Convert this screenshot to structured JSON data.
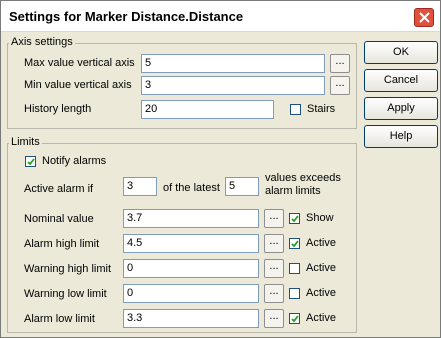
{
  "window": {
    "title": "Settings for Marker Distance.Distance"
  },
  "axis": {
    "legend": "Axis settings",
    "max_label": "Max value vertical axis",
    "max_value": "5",
    "min_label": "Min value vertical axis",
    "min_value": "3",
    "history_label": "History length",
    "history_value": "20",
    "stairs_label": "Stairs",
    "stairs_checked": false,
    "browse_label": "..."
  },
  "limits": {
    "legend": "Limits",
    "notify_label": "Notify alarms",
    "notify_checked": true,
    "active_if_label": "Active alarm if",
    "active_count": "3",
    "of_latest_label": "of the latest",
    "latest_count": "5",
    "exceeds_label_1": "values exceeds",
    "exceeds_label_2": "alarm limits",
    "rows": [
      {
        "label": "Nominal value",
        "value": "3.7",
        "check_label": "Show",
        "checked": true
      },
      {
        "label": "Alarm high limit",
        "value": "4.5",
        "check_label": "Active",
        "checked": true
      },
      {
        "label": "Warning high limit",
        "value": "0",
        "check_label": "Active",
        "checked": false
      },
      {
        "label": "Warning low limit",
        "value": "0",
        "check_label": "Active",
        "checked": false
      },
      {
        "label": "Alarm low limit",
        "value": "3.3",
        "check_label": "Active",
        "checked": true
      }
    ]
  },
  "buttons": {
    "ok": "OK",
    "cancel": "Cancel",
    "apply": "Apply",
    "help": "Help"
  },
  "colors": {
    "close_button": "#e1503c",
    "field_border": "#7f9db9",
    "dialog_bg": "#ece9d8"
  }
}
